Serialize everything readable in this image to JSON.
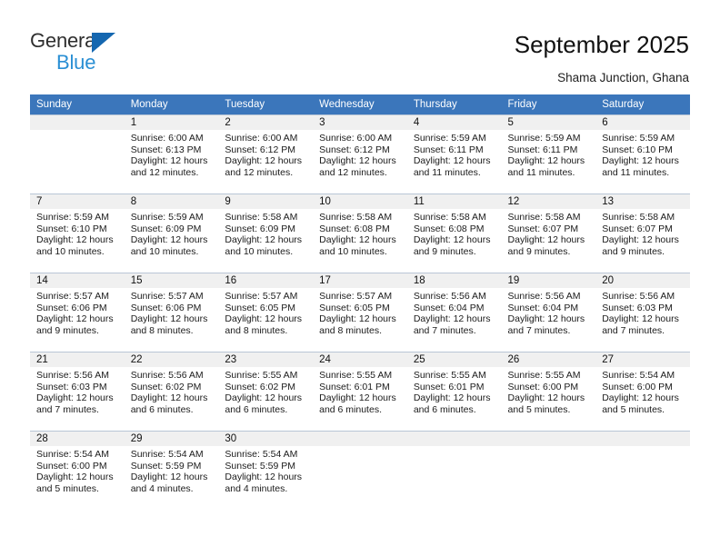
{
  "brand": {
    "name_part1": "General",
    "name_part2": "Blue",
    "triangle_icon": "triangle-icon",
    "accent_dark": "#1567b0",
    "accent_light": "#2a8fd4"
  },
  "header": {
    "title": "September 2025",
    "subtitle": "Shama Junction, Ghana"
  },
  "calendar": {
    "header_bg": "#3b76bb",
    "date_band_bg": "#f0f0f0",
    "weekdays": [
      "Sunday",
      "Monday",
      "Tuesday",
      "Wednesday",
      "Thursday",
      "Friday",
      "Saturday"
    ],
    "weeks": [
      [
        {
          "date": "",
          "sunrise": "",
          "sunset": "",
          "daylight_line1": "",
          "daylight_line2": "",
          "empty": true
        },
        {
          "date": "1",
          "sunrise": "Sunrise: 6:00 AM",
          "sunset": "Sunset: 6:13 PM",
          "daylight_line1": "Daylight: 12 hours",
          "daylight_line2": "and 12 minutes."
        },
        {
          "date": "2",
          "sunrise": "Sunrise: 6:00 AM",
          "sunset": "Sunset: 6:12 PM",
          "daylight_line1": "Daylight: 12 hours",
          "daylight_line2": "and 12 minutes."
        },
        {
          "date": "3",
          "sunrise": "Sunrise: 6:00 AM",
          "sunset": "Sunset: 6:12 PM",
          "daylight_line1": "Daylight: 12 hours",
          "daylight_line2": "and 12 minutes."
        },
        {
          "date": "4",
          "sunrise": "Sunrise: 5:59 AM",
          "sunset": "Sunset: 6:11 PM",
          "daylight_line1": "Daylight: 12 hours",
          "daylight_line2": "and 11 minutes."
        },
        {
          "date": "5",
          "sunrise": "Sunrise: 5:59 AM",
          "sunset": "Sunset: 6:11 PM",
          "daylight_line1": "Daylight: 12 hours",
          "daylight_line2": "and 11 minutes."
        },
        {
          "date": "6",
          "sunrise": "Sunrise: 5:59 AM",
          "sunset": "Sunset: 6:10 PM",
          "daylight_line1": "Daylight: 12 hours",
          "daylight_line2": "and 11 minutes."
        }
      ],
      [
        {
          "date": "7",
          "sunrise": "Sunrise: 5:59 AM",
          "sunset": "Sunset: 6:10 PM",
          "daylight_line1": "Daylight: 12 hours",
          "daylight_line2": "and 10 minutes."
        },
        {
          "date": "8",
          "sunrise": "Sunrise: 5:59 AM",
          "sunset": "Sunset: 6:09 PM",
          "daylight_line1": "Daylight: 12 hours",
          "daylight_line2": "and 10 minutes."
        },
        {
          "date": "9",
          "sunrise": "Sunrise: 5:58 AM",
          "sunset": "Sunset: 6:09 PM",
          "daylight_line1": "Daylight: 12 hours",
          "daylight_line2": "and 10 minutes."
        },
        {
          "date": "10",
          "sunrise": "Sunrise: 5:58 AM",
          "sunset": "Sunset: 6:08 PM",
          "daylight_line1": "Daylight: 12 hours",
          "daylight_line2": "and 10 minutes."
        },
        {
          "date": "11",
          "sunrise": "Sunrise: 5:58 AM",
          "sunset": "Sunset: 6:08 PM",
          "daylight_line1": "Daylight: 12 hours",
          "daylight_line2": "and 9 minutes."
        },
        {
          "date": "12",
          "sunrise": "Sunrise: 5:58 AM",
          "sunset": "Sunset: 6:07 PM",
          "daylight_line1": "Daylight: 12 hours",
          "daylight_line2": "and 9 minutes."
        },
        {
          "date": "13",
          "sunrise": "Sunrise: 5:58 AM",
          "sunset": "Sunset: 6:07 PM",
          "daylight_line1": "Daylight: 12 hours",
          "daylight_line2": "and 9 minutes."
        }
      ],
      [
        {
          "date": "14",
          "sunrise": "Sunrise: 5:57 AM",
          "sunset": "Sunset: 6:06 PM",
          "daylight_line1": "Daylight: 12 hours",
          "daylight_line2": "and 9 minutes."
        },
        {
          "date": "15",
          "sunrise": "Sunrise: 5:57 AM",
          "sunset": "Sunset: 6:06 PM",
          "daylight_line1": "Daylight: 12 hours",
          "daylight_line2": "and 8 minutes."
        },
        {
          "date": "16",
          "sunrise": "Sunrise: 5:57 AM",
          "sunset": "Sunset: 6:05 PM",
          "daylight_line1": "Daylight: 12 hours",
          "daylight_line2": "and 8 minutes."
        },
        {
          "date": "17",
          "sunrise": "Sunrise: 5:57 AM",
          "sunset": "Sunset: 6:05 PM",
          "daylight_line1": "Daylight: 12 hours",
          "daylight_line2": "and 8 minutes."
        },
        {
          "date": "18",
          "sunrise": "Sunrise: 5:56 AM",
          "sunset": "Sunset: 6:04 PM",
          "daylight_line1": "Daylight: 12 hours",
          "daylight_line2": "and 7 minutes."
        },
        {
          "date": "19",
          "sunrise": "Sunrise: 5:56 AM",
          "sunset": "Sunset: 6:04 PM",
          "daylight_line1": "Daylight: 12 hours",
          "daylight_line2": "and 7 minutes."
        },
        {
          "date": "20",
          "sunrise": "Sunrise: 5:56 AM",
          "sunset": "Sunset: 6:03 PM",
          "daylight_line1": "Daylight: 12 hours",
          "daylight_line2": "and 7 minutes."
        }
      ],
      [
        {
          "date": "21",
          "sunrise": "Sunrise: 5:56 AM",
          "sunset": "Sunset: 6:03 PM",
          "daylight_line1": "Daylight: 12 hours",
          "daylight_line2": "and 7 minutes."
        },
        {
          "date": "22",
          "sunrise": "Sunrise: 5:56 AM",
          "sunset": "Sunset: 6:02 PM",
          "daylight_line1": "Daylight: 12 hours",
          "daylight_line2": "and 6 minutes."
        },
        {
          "date": "23",
          "sunrise": "Sunrise: 5:55 AM",
          "sunset": "Sunset: 6:02 PM",
          "daylight_line1": "Daylight: 12 hours",
          "daylight_line2": "and 6 minutes."
        },
        {
          "date": "24",
          "sunrise": "Sunrise: 5:55 AM",
          "sunset": "Sunset: 6:01 PM",
          "daylight_line1": "Daylight: 12 hours",
          "daylight_line2": "and 6 minutes."
        },
        {
          "date": "25",
          "sunrise": "Sunrise: 5:55 AM",
          "sunset": "Sunset: 6:01 PM",
          "daylight_line1": "Daylight: 12 hours",
          "daylight_line2": "and 6 minutes."
        },
        {
          "date": "26",
          "sunrise": "Sunrise: 5:55 AM",
          "sunset": "Sunset: 6:00 PM",
          "daylight_line1": "Daylight: 12 hours",
          "daylight_line2": "and 5 minutes."
        },
        {
          "date": "27",
          "sunrise": "Sunrise: 5:54 AM",
          "sunset": "Sunset: 6:00 PM",
          "daylight_line1": "Daylight: 12 hours",
          "daylight_line2": "and 5 minutes."
        }
      ],
      [
        {
          "date": "28",
          "sunrise": "Sunrise: 5:54 AM",
          "sunset": "Sunset: 6:00 PM",
          "daylight_line1": "Daylight: 12 hours",
          "daylight_line2": "and 5 minutes."
        },
        {
          "date": "29",
          "sunrise": "Sunrise: 5:54 AM",
          "sunset": "Sunset: 5:59 PM",
          "daylight_line1": "Daylight: 12 hours",
          "daylight_line2": "and 4 minutes."
        },
        {
          "date": "30",
          "sunrise": "Sunrise: 5:54 AM",
          "sunset": "Sunset: 5:59 PM",
          "daylight_line1": "Daylight: 12 hours",
          "daylight_line2": "and 4 minutes."
        },
        {
          "date": "",
          "sunrise": "",
          "sunset": "",
          "daylight_line1": "",
          "daylight_line2": "",
          "empty": true
        },
        {
          "date": "",
          "sunrise": "",
          "sunset": "",
          "daylight_line1": "",
          "daylight_line2": "",
          "empty": true
        },
        {
          "date": "",
          "sunrise": "",
          "sunset": "",
          "daylight_line1": "",
          "daylight_line2": "",
          "empty": true
        },
        {
          "date": "",
          "sunrise": "",
          "sunset": "",
          "daylight_line1": "",
          "daylight_line2": "",
          "empty": true
        }
      ]
    ]
  }
}
